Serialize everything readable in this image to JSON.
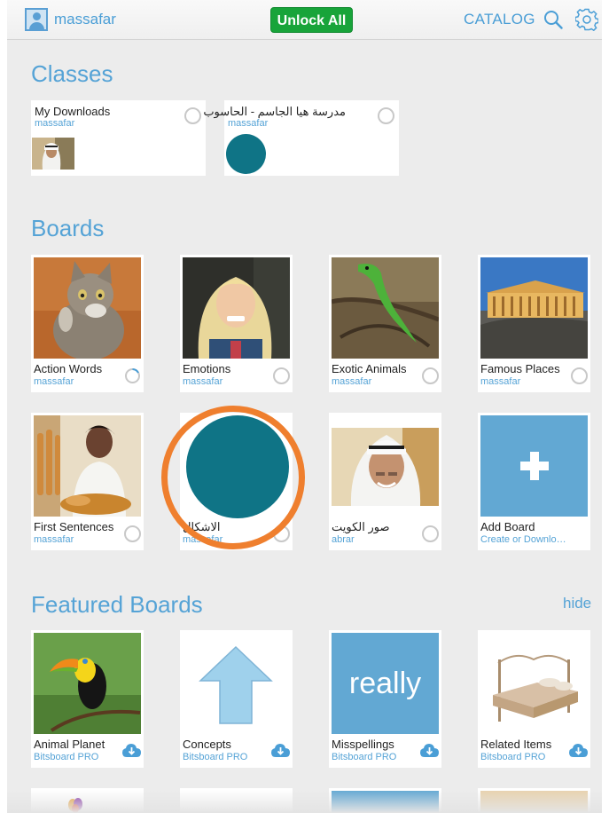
{
  "topbar": {
    "username": "massafar",
    "unlock_label": "Unlock All",
    "catalog_label": "CATALOG"
  },
  "classes": {
    "title": "Classes",
    "items": [
      {
        "title": "My Downloads",
        "owner": "massafar"
      },
      {
        "title": "مدرسة هيا الجاسم - الحاسوب",
        "owner": "massafar"
      }
    ]
  },
  "boards": {
    "title": "Boards",
    "items": [
      {
        "title": "Action Words",
        "owner": "massafar"
      },
      {
        "title": "Emotions",
        "owner": "massafar"
      },
      {
        "title": "Exotic Animals",
        "owner": "massafar"
      },
      {
        "title": "Famous Places",
        "owner": "massafar"
      },
      {
        "title": "First Sentences",
        "owner": "massafar"
      },
      {
        "title": "الاشكال",
        "owner": "massafar"
      },
      {
        "title": "صور الكويت",
        "owner": "abrar"
      },
      {
        "title": "Add Board",
        "owner": "Create or Downlo…"
      }
    ]
  },
  "featured": {
    "title": "Featured Boards",
    "hide_label": "hide",
    "items": [
      {
        "title": "Animal Planet",
        "owner": "Bitsboard PRO"
      },
      {
        "title": "Concepts",
        "owner": "Bitsboard PRO"
      },
      {
        "title": "Misspellings",
        "owner": "Bitsboard PRO",
        "image_text": "really"
      },
      {
        "title": "Related Items",
        "owner": "Bitsboard PRO"
      }
    ]
  },
  "colors": {
    "accent_blue": "#55a3d6",
    "unlock_green": "#18a43a",
    "teal_circle": "#0f7486",
    "highlight_orange": "#ef7f2e",
    "tile_blue": "#62a8d3"
  }
}
